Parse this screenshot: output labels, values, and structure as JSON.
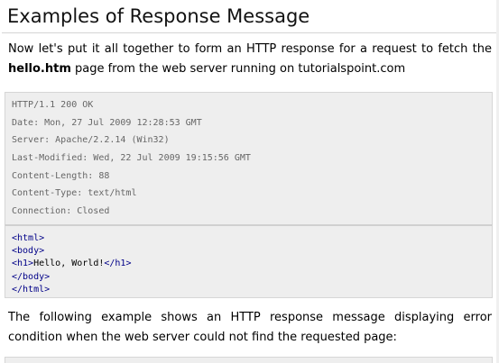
{
  "heading": "Examples of Response Message",
  "intro": {
    "text_before": "Now let's put it all together to form an HTTP response for a request to fetch the ",
    "bold": "hello.htm",
    "text_after": " page from the web server running on tutorialspoint.com"
  },
  "response_headers": [
    "HTTP/1.1 200 OK",
    "Date: Mon, 27 Jul 2009 12:28:53 GMT",
    "Server: Apache/2.2.14 (Win32)",
    "Last-Modified: Wed, 22 Jul 2009 19:15:56 GMT",
    "Content-Length: 88",
    "Content-Type: text/html",
    "Connection: Closed"
  ],
  "response_body": {
    "html_open": "<html>",
    "body_open": "<body>",
    "h1_open": "<h1>",
    "h1_text": "Hello, World!",
    "h1_close": "</h1>",
    "body_close": "</body>",
    "html_close": "</html>"
  },
  "second_para": "The following example shows an HTTP response message displaying error condition when the web server could not find the requested page:"
}
